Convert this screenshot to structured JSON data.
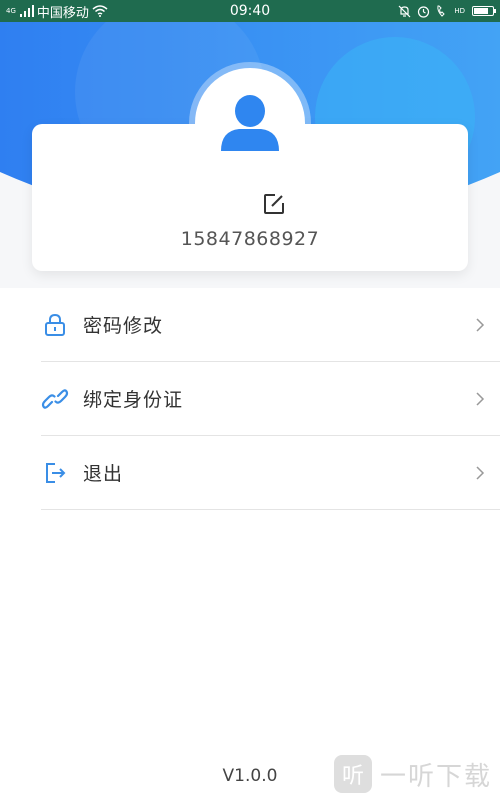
{
  "status_bar": {
    "signal_tag": "4G",
    "carrier": "中国移动",
    "time": "09:40",
    "hd_tag": "HD",
    "battery_level": 0.8,
    "color": "#1f6b4f"
  },
  "header": {
    "gradient_start": "#2f7ff1",
    "gradient_end": "#43a3f5",
    "bubble_color": "#3ab5f6"
  },
  "profile": {
    "avatar_icon": "user-icon",
    "edit_icon": "edit-icon",
    "phone": "15847868927"
  },
  "menu": {
    "items": [
      {
        "icon": "lock-icon",
        "label": "密码修改"
      },
      {
        "icon": "link-icon",
        "label": "绑定身份证"
      },
      {
        "icon": "logout-icon",
        "label": "退出"
      }
    ],
    "icon_color": "#3a8ee6",
    "chevron_icon": "chevron-right-icon"
  },
  "footer": {
    "version": "V1.0.0"
  },
  "watermark": {
    "badge": "听",
    "text": "一听下载"
  }
}
